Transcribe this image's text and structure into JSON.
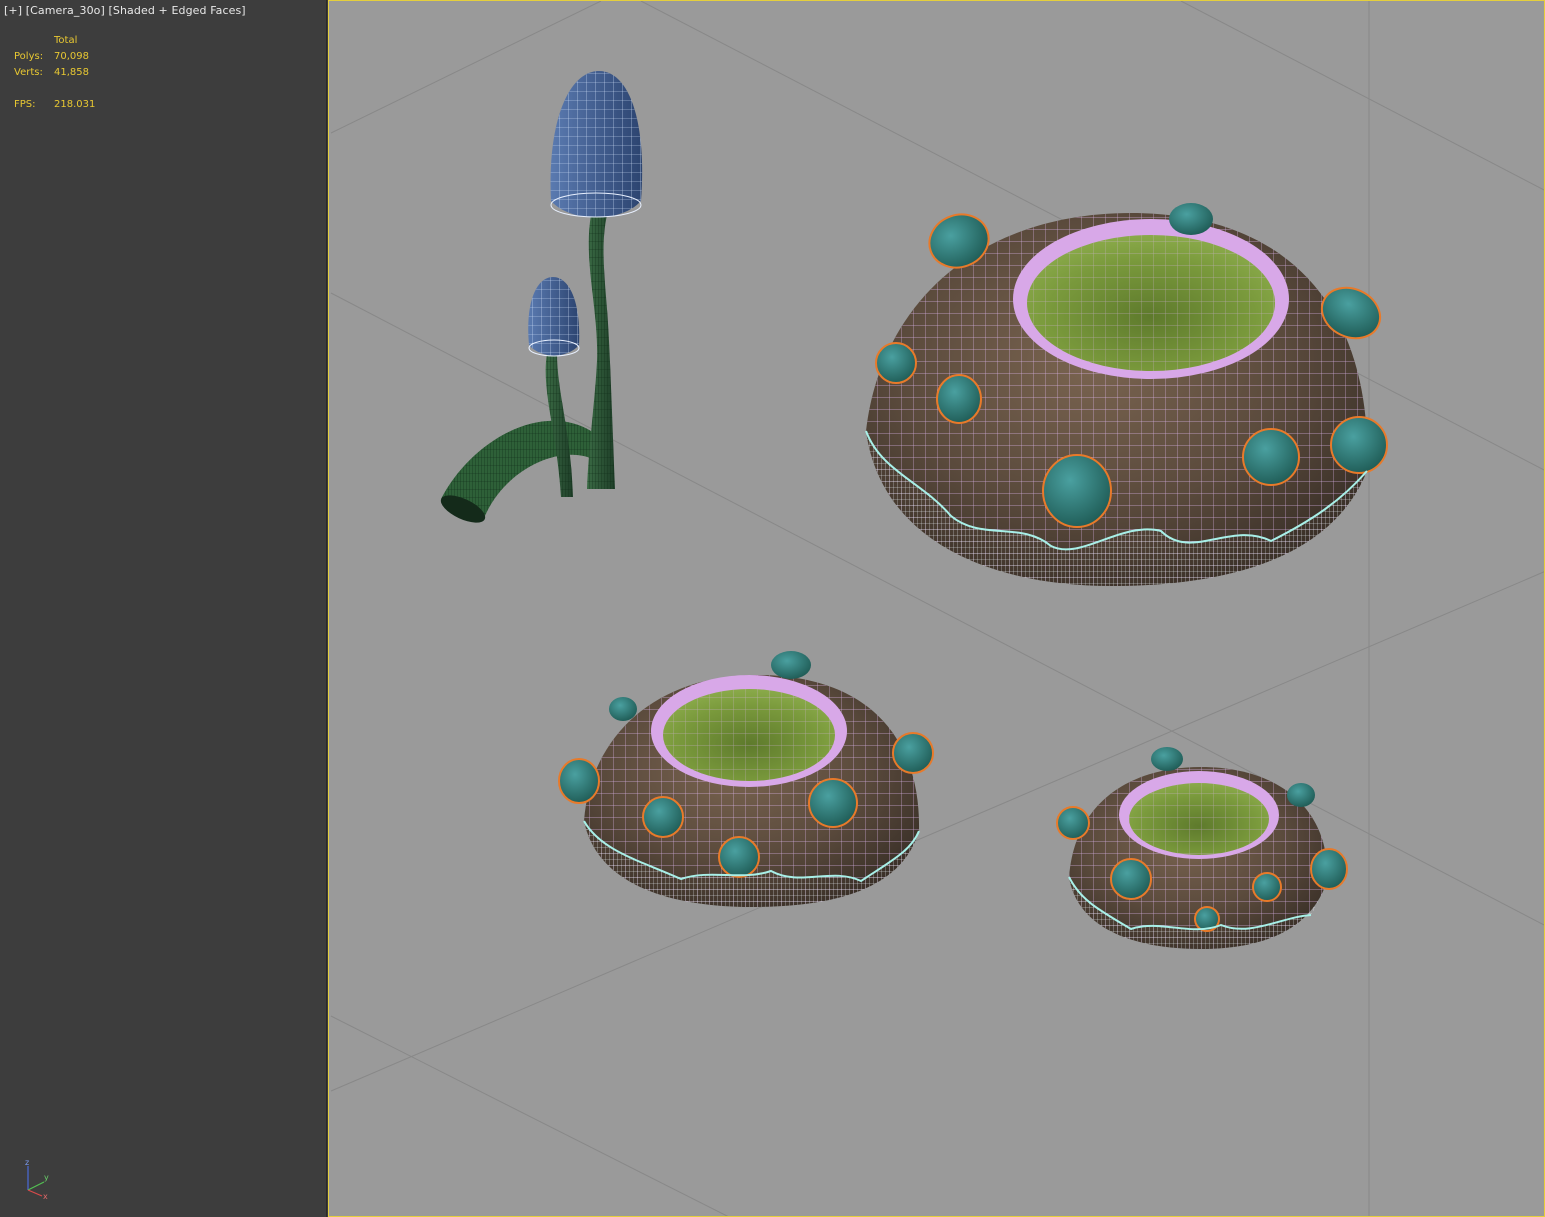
{
  "viewport_label": {
    "menu": "[+]",
    "camera": "[Camera_30o]",
    "shading": "[Shaded + Edged Faces]"
  },
  "stats": {
    "header": "Total",
    "polys_label": "Polys:",
    "polys_value": "70,098",
    "verts_label": "Verts:",
    "verts_value": "41,858",
    "fps_label": "FPS:",
    "fps_value": "218.031"
  },
  "gizmo": {
    "x": "x",
    "y": "y",
    "z": "z"
  },
  "colors": {
    "panel_bg": "#3d3d3d",
    "viewport_bg": "#9a9a9a",
    "active_border": "#e5cf3c",
    "stats_text": "#e8c832",
    "grid_line": "#8a8a8a",
    "wire_white": "#e8e8ff",
    "wire_pink": "#e0b0f0",
    "wire_cyan": "#a8f0e8",
    "wire_orange": "#e87a2a",
    "pot_body": "#5a4a3c",
    "pot_inner": "#6c8a34",
    "nub": "#2c7a72",
    "mushroom_cap": "#3c5a8c",
    "stem": "#2a5a38"
  },
  "scene_objects": [
    "tall-mushroom",
    "small-mushroom",
    "root-arch",
    "large-pot",
    "medium-pot",
    "small-pot"
  ]
}
